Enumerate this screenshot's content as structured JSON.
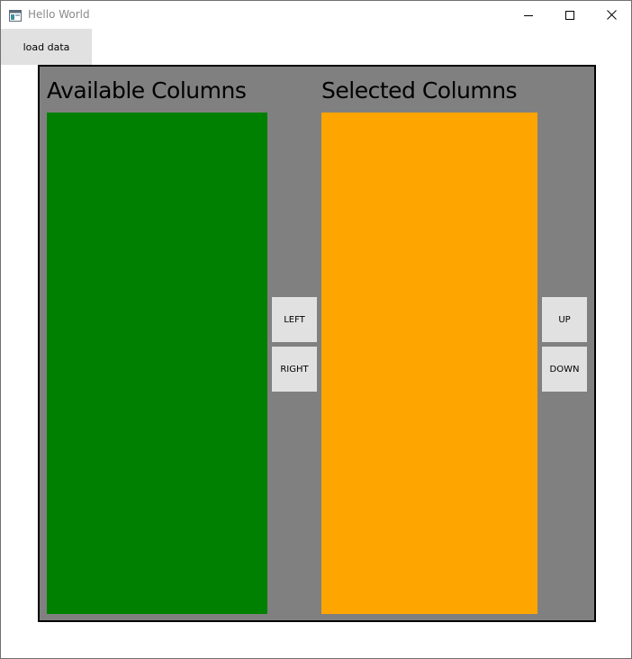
{
  "window": {
    "title": "Hello World"
  },
  "toolbar": {
    "load_data_label": "load data"
  },
  "panel": {
    "available_title": "Available Columns",
    "selected_title": "Selected Columns",
    "left_label": "LEFT",
    "right_label": "RIGHT",
    "up_label": "UP",
    "down_label": "DOWN"
  },
  "colors": {
    "panel_background": "#808080",
    "available_list": "#008000",
    "selected_list": "#ffa500",
    "button_face": "#e1e1e1"
  },
  "icons": {
    "app": "app-window-icon",
    "minimize": "minimize-icon",
    "maximize": "maximize-icon",
    "close": "close-icon"
  }
}
